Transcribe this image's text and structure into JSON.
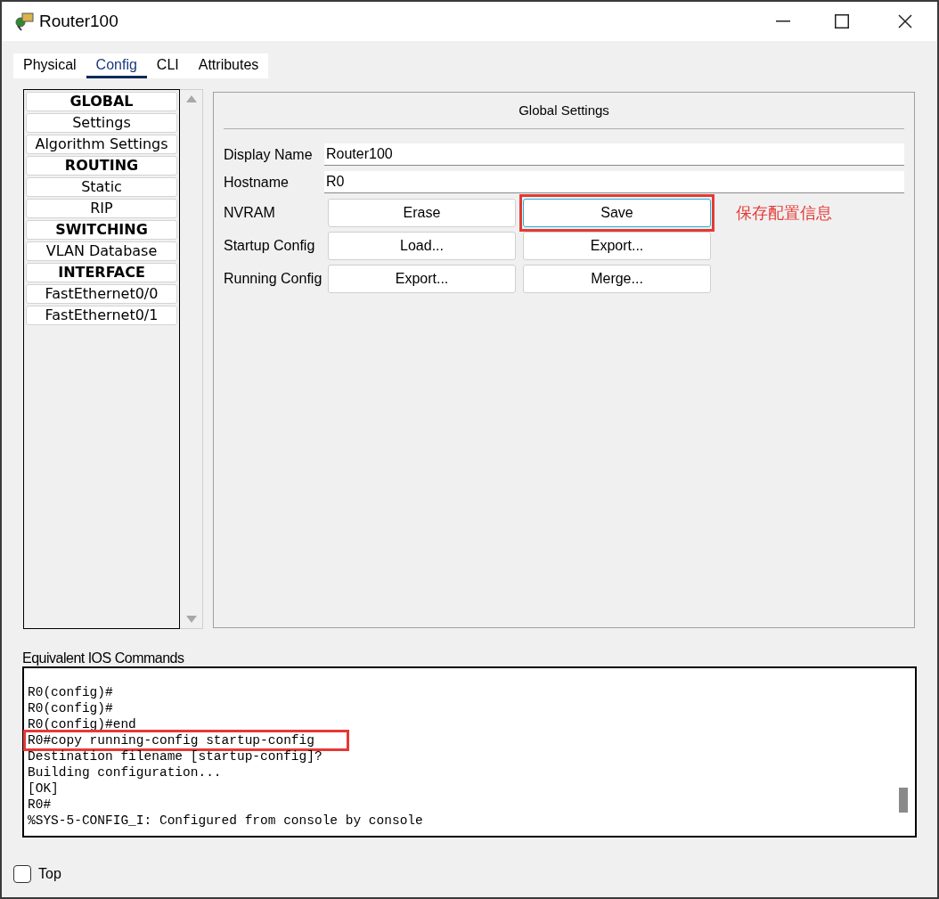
{
  "window": {
    "title": "Router100"
  },
  "tabs": [
    {
      "label": "Physical",
      "selected": false
    },
    {
      "label": "Config",
      "selected": true
    },
    {
      "label": "CLI",
      "selected": false
    },
    {
      "label": "Attributes",
      "selected": false
    }
  ],
  "sidebar": {
    "items": [
      {
        "label": "GLOBAL",
        "kind": "header"
      },
      {
        "label": "Settings",
        "kind": "item"
      },
      {
        "label": "Algorithm Settings",
        "kind": "item"
      },
      {
        "label": "ROUTING",
        "kind": "header"
      },
      {
        "label": "Static",
        "kind": "item"
      },
      {
        "label": "RIP",
        "kind": "item"
      },
      {
        "label": "SWITCHING",
        "kind": "header"
      },
      {
        "label": "VLAN Database",
        "kind": "item"
      },
      {
        "label": "INTERFACE",
        "kind": "header"
      },
      {
        "label": "FastEthernet0/0",
        "kind": "item"
      },
      {
        "label": "FastEthernet0/1",
        "kind": "item"
      }
    ]
  },
  "panel": {
    "title": "Global Settings",
    "fields": [
      {
        "label": "Display Name",
        "value": "Router100"
      },
      {
        "label": "Hostname",
        "value": "R0"
      }
    ],
    "button_rows": [
      {
        "label": "NVRAM",
        "buttons": [
          {
            "label": "Erase",
            "focused": false,
            "highlighted": false
          },
          {
            "label": "Save",
            "focused": true,
            "highlighted": true
          }
        ]
      },
      {
        "label": "Startup Config",
        "buttons": [
          {
            "label": "Load...",
            "focused": false,
            "highlighted": false
          },
          {
            "label": "Export...",
            "focused": false,
            "highlighted": false
          }
        ]
      },
      {
        "label": "Running Config",
        "buttons": [
          {
            "label": "Export...",
            "focused": false,
            "highlighted": false
          },
          {
            "label": "Merge...",
            "focused": false,
            "highlighted": false
          }
        ]
      }
    ],
    "annotation": "保存配置信息"
  },
  "console": {
    "label": "Equivalent IOS Commands",
    "lines": [
      {
        "text": "R0(config)#",
        "highlighted": false
      },
      {
        "text": "R0(config)#",
        "highlighted": false
      },
      {
        "text": "R0(config)#end",
        "highlighted": false
      },
      {
        "text": "R0#copy running-config startup-config",
        "highlighted": true
      },
      {
        "text": "Destination filename [startup-config]?",
        "highlighted": false
      },
      {
        "text": "Building configuration...",
        "highlighted": false
      },
      {
        "text": "[OK]",
        "highlighted": false
      },
      {
        "text": "R0#",
        "highlighted": false
      },
      {
        "text": "%SYS-5-CONFIG_I: Configured from console by console",
        "highlighted": false
      }
    ]
  },
  "top_checkbox": {
    "label": "Top",
    "checked": false
  }
}
